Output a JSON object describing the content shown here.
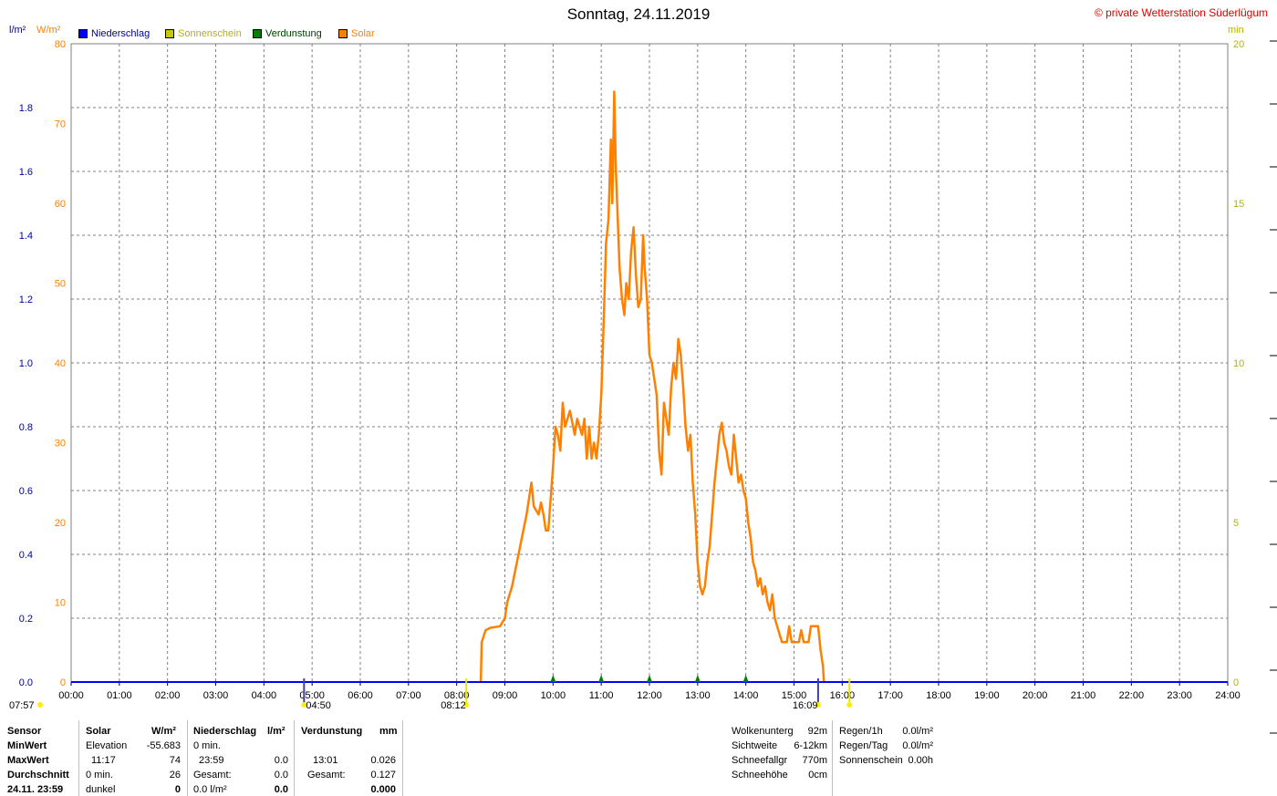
{
  "title": "Sonntag, 24.11.2019",
  "copyright": "© private Wetterstation Süderlügum",
  "units": {
    "left_rain": "l/m²",
    "left_solar": "W/m²",
    "right_sun": "min"
  },
  "legend": [
    {
      "label": "Niederschlag",
      "color": "#0000ff",
      "text_color": "#0000a0"
    },
    {
      "label": "Sonnenschein",
      "color": "#c8c800",
      "text_color": "#b4b400"
    },
    {
      "label": "Verdunstung",
      "color": "#008000",
      "text_color": "#004000"
    },
    {
      "label": "Solar",
      "color": "#ff8000",
      "text_color": "#ff8000"
    }
  ],
  "chart_data": {
    "type": "line",
    "title": "Sonntag, 24.11.2019",
    "x_tick_labels": [
      "00:00",
      "01:00",
      "02:00",
      "03:00",
      "04:00",
      "05:00",
      "06:00",
      "07:00",
      "08:00",
      "09:00",
      "10:00",
      "11:00",
      "12:00",
      "13:00",
      "14:00",
      "15:00",
      "16:00",
      "17:00",
      "18:00",
      "19:00",
      "20:00",
      "21:00",
      "22:00",
      "23:00",
      "24:00"
    ],
    "xlim_hours": [
      0,
      24
    ],
    "y_axes": {
      "solar": {
        "label": "W/m²",
        "ylim": [
          0,
          80
        ],
        "ticks": [
          0,
          10,
          20,
          30,
          40,
          50,
          60,
          70,
          80
        ],
        "color": "#ff8000"
      },
      "rain": {
        "label": "l/m²",
        "ylim": [
          0,
          2.0
        ],
        "ticks": [
          "0.0",
          "0.2",
          "0.4",
          "0.6",
          "0.8",
          "1.0",
          "1.2",
          "1.4",
          "1.6",
          "1.8"
        ],
        "color": "#0000a0"
      },
      "sun": {
        "label": "min",
        "ylim": [
          0,
          20
        ],
        "ticks": [
          0,
          5,
          10,
          15,
          20
        ],
        "color": "#b4b400"
      }
    },
    "grid": true,
    "series": [
      {
        "name": "Solar",
        "color": "#ff8000",
        "axis": "solar",
        "points": [
          [
            8.5,
            0
          ],
          [
            8.52,
            5
          ],
          [
            8.6,
            6.5
          ],
          [
            8.7,
            6.8
          ],
          [
            8.9,
            7
          ],
          [
            9.0,
            8
          ],
          [
            9.05,
            10
          ],
          [
            9.15,
            12
          ],
          [
            9.25,
            15
          ],
          [
            9.35,
            18
          ],
          [
            9.45,
            21
          ],
          [
            9.55,
            25
          ],
          [
            9.6,
            22
          ],
          [
            9.7,
            21
          ],
          [
            9.75,
            22.5
          ],
          [
            9.8,
            21
          ],
          [
            9.85,
            19
          ],
          [
            9.9,
            19
          ],
          [
            9.95,
            23
          ],
          [
            10.0,
            27
          ],
          [
            10.05,
            32
          ],
          [
            10.1,
            31
          ],
          [
            10.15,
            29
          ],
          [
            10.2,
            35
          ],
          [
            10.25,
            32
          ],
          [
            10.35,
            34
          ],
          [
            10.45,
            31
          ],
          [
            10.5,
            33
          ],
          [
            10.6,
            31
          ],
          [
            10.65,
            33
          ],
          [
            10.7,
            28
          ],
          [
            10.75,
            32
          ],
          [
            10.8,
            28
          ],
          [
            10.85,
            30
          ],
          [
            10.9,
            28
          ],
          [
            10.95,
            31
          ],
          [
            11.0,
            36
          ],
          [
            11.05,
            45
          ],
          [
            11.1,
            55
          ],
          [
            11.15,
            58
          ],
          [
            11.2,
            68
          ],
          [
            11.23,
            60
          ],
          [
            11.27,
            74
          ],
          [
            11.3,
            65
          ],
          [
            11.33,
            60
          ],
          [
            11.38,
            52
          ],
          [
            11.43,
            48
          ],
          [
            11.48,
            46
          ],
          [
            11.52,
            50
          ],
          [
            11.57,
            48
          ],
          [
            11.62,
            54
          ],
          [
            11.67,
            57
          ],
          [
            11.72,
            51
          ],
          [
            11.77,
            47
          ],
          [
            11.82,
            48
          ],
          [
            11.87,
            56
          ],
          [
            11.9,
            52
          ],
          [
            11.95,
            48
          ],
          [
            12.0,
            41
          ],
          [
            12.05,
            40
          ],
          [
            12.1,
            38
          ],
          [
            12.15,
            36
          ],
          [
            12.2,
            29
          ],
          [
            12.25,
            26
          ],
          [
            12.3,
            35
          ],
          [
            12.35,
            33
          ],
          [
            12.4,
            31
          ],
          [
            12.45,
            37
          ],
          [
            12.5,
            40
          ],
          [
            12.55,
            38
          ],
          [
            12.6,
            43
          ],
          [
            12.65,
            41
          ],
          [
            12.7,
            37
          ],
          [
            12.75,
            32
          ],
          [
            12.8,
            29
          ],
          [
            12.85,
            31
          ],
          [
            12.9,
            25
          ],
          [
            12.95,
            21
          ],
          [
            13.0,
            15
          ],
          [
            13.05,
            12
          ],
          [
            13.1,
            11
          ],
          [
            13.15,
            12
          ],
          [
            13.2,
            15
          ],
          [
            13.25,
            17
          ],
          [
            13.3,
            21
          ],
          [
            13.35,
            25
          ],
          [
            13.4,
            28
          ],
          [
            13.45,
            31
          ],
          [
            13.5,
            32.5
          ],
          [
            13.55,
            30
          ],
          [
            13.6,
            29
          ],
          [
            13.65,
            27
          ],
          [
            13.7,
            26
          ],
          [
            13.75,
            31
          ],
          [
            13.8,
            28
          ],
          [
            13.85,
            25
          ],
          [
            13.9,
            26
          ],
          [
            13.95,
            24
          ],
          [
            14.0,
            23
          ],
          [
            14.05,
            20
          ],
          [
            14.1,
            18
          ],
          [
            14.15,
            15
          ],
          [
            14.2,
            14
          ],
          [
            14.25,
            12
          ],
          [
            14.3,
            13
          ],
          [
            14.35,
            11
          ],
          [
            14.4,
            12
          ],
          [
            14.45,
            10
          ],
          [
            14.5,
            9
          ],
          [
            14.55,
            11
          ],
          [
            14.6,
            8
          ],
          [
            14.65,
            7
          ],
          [
            14.7,
            6
          ],
          [
            14.75,
            5
          ],
          [
            14.8,
            5
          ],
          [
            14.85,
            5
          ],
          [
            14.9,
            7
          ],
          [
            14.95,
            5
          ],
          [
            15.0,
            5
          ],
          [
            15.1,
            5
          ],
          [
            15.15,
            6.5
          ],
          [
            15.2,
            5
          ],
          [
            15.3,
            5
          ],
          [
            15.35,
            7
          ],
          [
            15.45,
            7
          ],
          [
            15.5,
            7
          ],
          [
            15.55,
            4
          ],
          [
            15.6,
            2
          ],
          [
            15.62,
            0
          ]
        ]
      },
      {
        "name": "Niederschlag",
        "color": "#0000ff",
        "axis": "rain",
        "points": [
          [
            0,
            0
          ],
          [
            24,
            0
          ]
        ]
      },
      {
        "name": "Verdunstung",
        "color": "#008000",
        "axis": "rain",
        "marker_hours": [
          10,
          11,
          12,
          13,
          14
        ]
      }
    ],
    "sun_marks": [
      {
        "hour": 4.833,
        "label": "04:50"
      },
      {
        "hour": 8.2,
        "label": "08:12"
      },
      {
        "hour": 15.5,
        "label": "16:09"
      },
      {
        "hour": 16.15,
        "label": ""
      }
    ],
    "edge_labels": {
      "left": "07:57"
    }
  },
  "table_left": {
    "headers": [
      "Sensor",
      "Solar",
      "W/m²",
      "Niederschlag",
      "l/m²",
      "Verdunstung",
      "mm"
    ],
    "rows": [
      [
        "MinWert",
        "Elevation",
        "-55.683",
        "0 min.",
        "",
        "",
        ""
      ],
      [
        "MaxWert",
        "11:17",
        "74",
        "23:59",
        "0.0",
        "13:01",
        "0.026"
      ],
      [
        "Durchschnitt",
        "0 min.",
        "26",
        "Gesamt:",
        "0.0",
        "Gesamt:",
        "0.127"
      ],
      [
        "24.11. 23:59",
        "dunkel",
        "0",
        "0.0 l/m²",
        "0.0",
        "",
        "0.000"
      ]
    ]
  },
  "table_right": {
    "rows": [
      [
        "Wolkenunterg",
        "92m",
        "Regen/1h",
        "0.0l/m²"
      ],
      [
        "Sichtweite",
        "6-12km",
        "Regen/Tag",
        "0.0l/m²"
      ],
      [
        "Schneefallgr",
        "770m",
        "Sonnenschein",
        "0.00h"
      ],
      [
        "Schneehöhe",
        "0cm",
        "",
        ""
      ]
    ]
  }
}
